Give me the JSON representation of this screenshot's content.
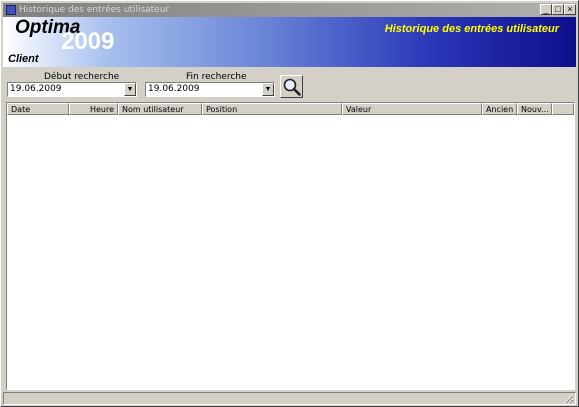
{
  "window": {
    "title": "Historique des entrées utilisateur",
    "controls": {
      "minimize": "_",
      "maximize": "□",
      "close": "×"
    }
  },
  "banner": {
    "brand": "Optima",
    "year": "2009",
    "edition": "Client",
    "heading": "Historique des entrées utilisateur",
    "colors": {
      "heading": "#ffff00",
      "gradient_end": "#0e0e8c"
    }
  },
  "search": {
    "start_label": "Début recherche",
    "start_value": "19.06.2009",
    "end_label": "Fin recherche",
    "end_value": "19.06.2009",
    "button_icon": "magnifier-icon"
  },
  "table": {
    "columns": [
      "Date",
      "Heure",
      "Nom utilisateur",
      "Position",
      "Valeur",
      "Ancien",
      "Nouv..."
    ],
    "rows": []
  }
}
